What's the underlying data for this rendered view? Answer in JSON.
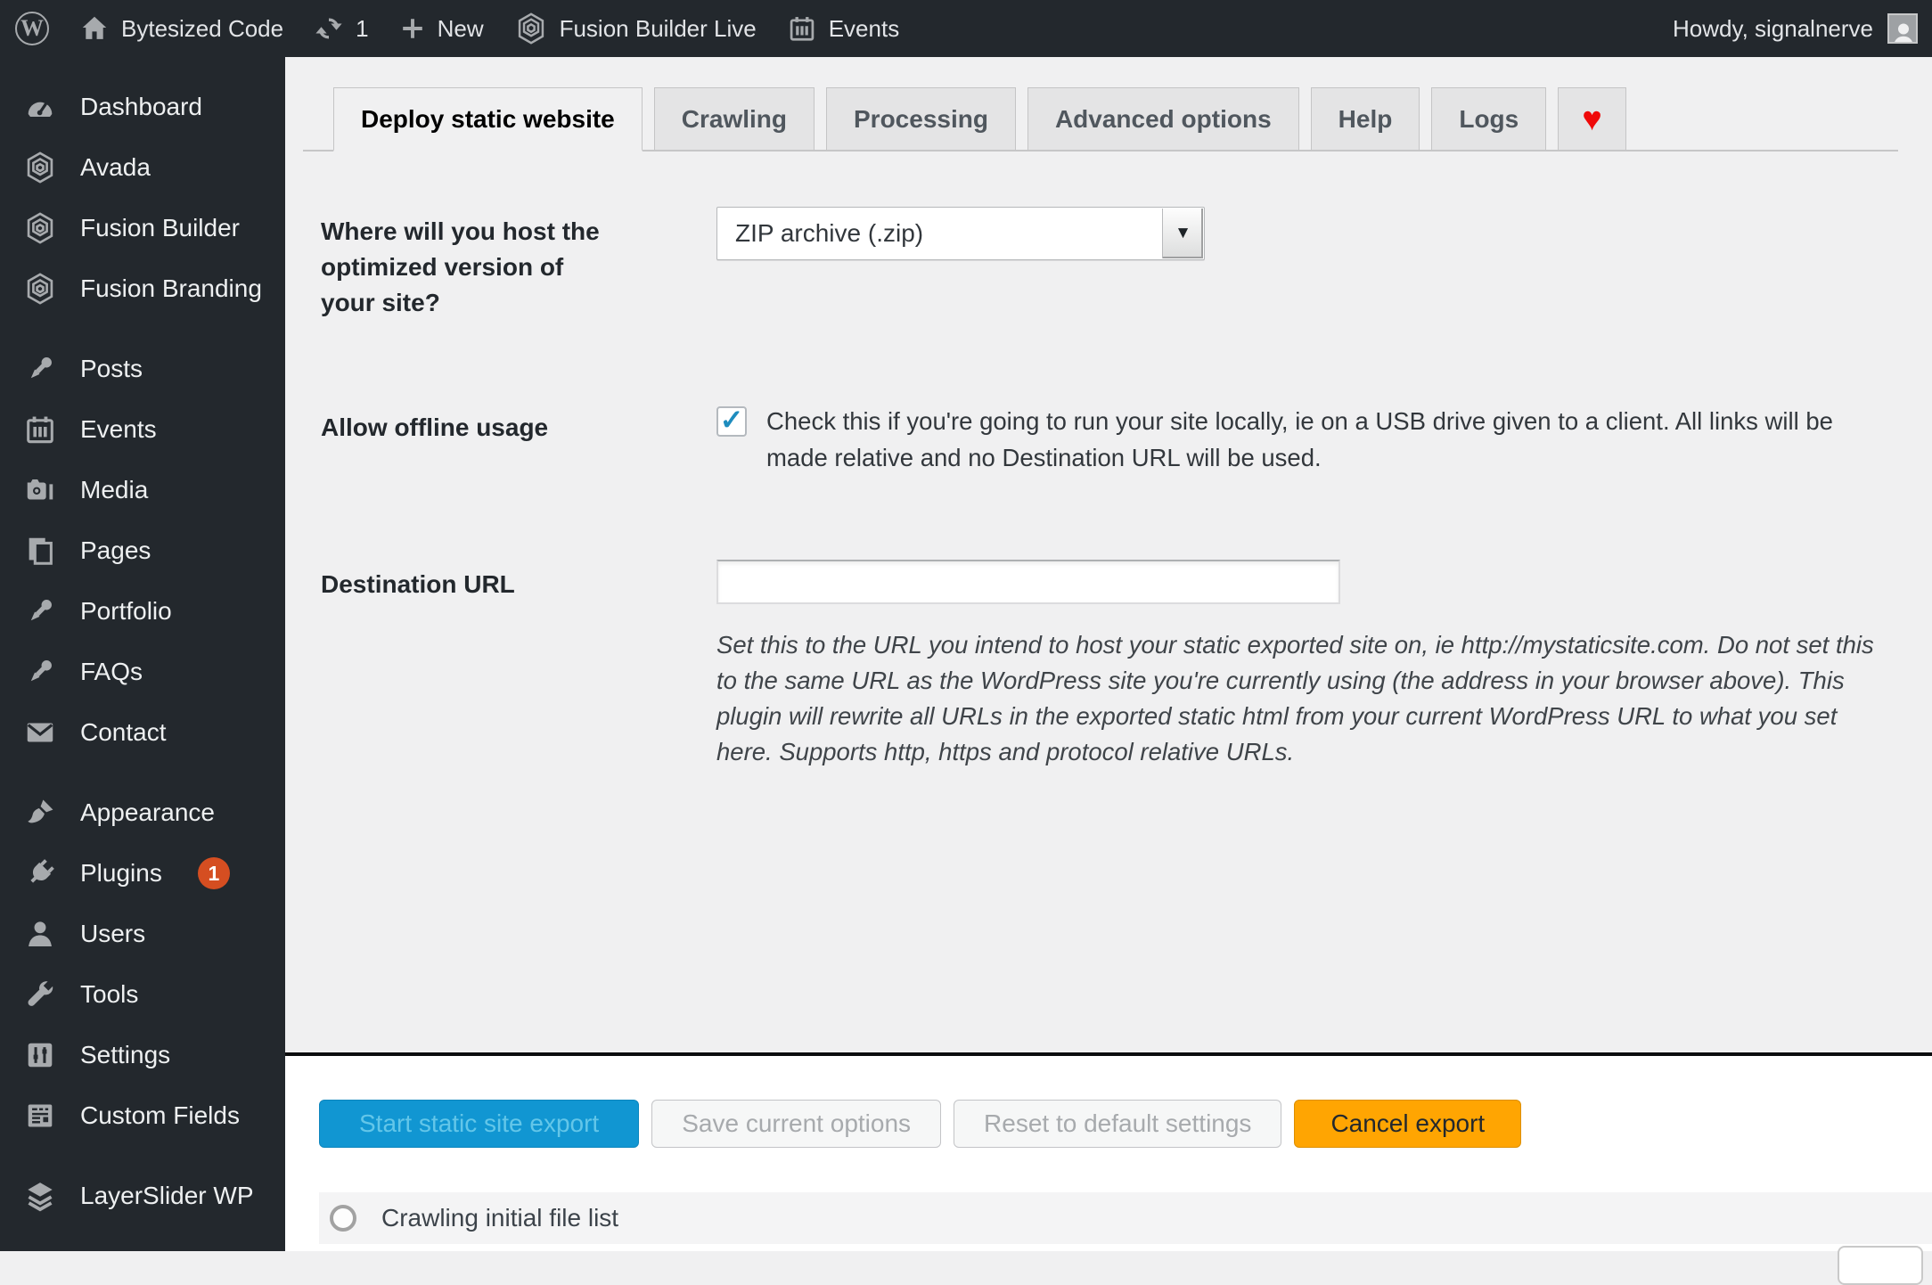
{
  "admin_bar": {
    "wp_logo_letter": "W",
    "site_name": "Bytesized Code",
    "updates_count": "1",
    "new_label": "New",
    "fusion_builder_live_label": "Fusion Builder Live",
    "events_label": "Events",
    "howdy": "Howdy, signalnerve"
  },
  "sidebar": {
    "items": [
      {
        "label": "Dashboard",
        "icon": "gauge-icon"
      },
      {
        "label": "Avada",
        "icon": "avada-hexagon-icon"
      },
      {
        "label": "Fusion Builder",
        "icon": "fusion-hexagon-icon"
      },
      {
        "label": "Fusion Branding",
        "icon": "fusion-hexagon-icon"
      },
      {
        "label": "Posts",
        "icon": "pushpin-icon"
      },
      {
        "label": "Events",
        "icon": "calendar-icon"
      },
      {
        "label": "Media",
        "icon": "camera-icon"
      },
      {
        "label": "Pages",
        "icon": "pages-icon"
      },
      {
        "label": "Portfolio",
        "icon": "pushpin-icon"
      },
      {
        "label": "FAQs",
        "icon": "pushpin-icon"
      },
      {
        "label": "Contact",
        "icon": "envelope-icon"
      },
      {
        "label": "Appearance",
        "icon": "brush-icon"
      },
      {
        "label": "Plugins",
        "icon": "plug-icon",
        "badge": "1"
      },
      {
        "label": "Users",
        "icon": "user-icon"
      },
      {
        "label": "Tools",
        "icon": "wrench-icon"
      },
      {
        "label": "Settings",
        "icon": "sliders-icon"
      },
      {
        "label": "Custom Fields",
        "icon": "fields-icon"
      },
      {
        "label": "LayerSlider WP",
        "icon": "layers-icon"
      }
    ]
  },
  "tabs": {
    "items": [
      {
        "label": "Deploy static website",
        "active": true
      },
      {
        "label": "Crawling"
      },
      {
        "label": "Processing"
      },
      {
        "label": "Advanced options"
      },
      {
        "label": "Help"
      },
      {
        "label": "Logs"
      },
      {
        "label": "♥",
        "is_heart": true
      }
    ]
  },
  "form": {
    "host_question": "Where will you host the optimized version of your site?",
    "host_select_value": "ZIP archive (.zip)",
    "offline_label": "Allow offline usage",
    "offline_help": "Check this if you're going to run your site locally, ie on a USB drive given to a client. All links will be made relative and no Destination URL will be used.",
    "destination_label": "Destination URL",
    "destination_value": "",
    "destination_help": "Set this to the URL you intend to host your static exported site on, ie http://mystaticsite.com. Do not set this to the same URL as the WordPress site you're currently using (the address in your browser above). This plugin will rewrite all URLs in the exported static html from your current WordPress URL to what you set here. Supports http, https and protocol relative URLs."
  },
  "actions": {
    "start": "Start static site export",
    "save": "Save current options",
    "reset": "Reset to default settings",
    "cancel": "Cancel export"
  },
  "progress": {
    "first_step": "Crawling initial file list"
  },
  "icons": {
    "check": "✓",
    "select_arrow": "▼"
  },
  "colors": {
    "admin_dark": "#23282d",
    "page_bg": "#f0f0f1",
    "primary_blue": "#1196d2",
    "primary_blue_text": "#63c6e9",
    "cancel_orange": "#ffa502",
    "badge_red": "#d54e21",
    "heart_red": "#ef0909",
    "check_blue": "#1e8cbe"
  }
}
